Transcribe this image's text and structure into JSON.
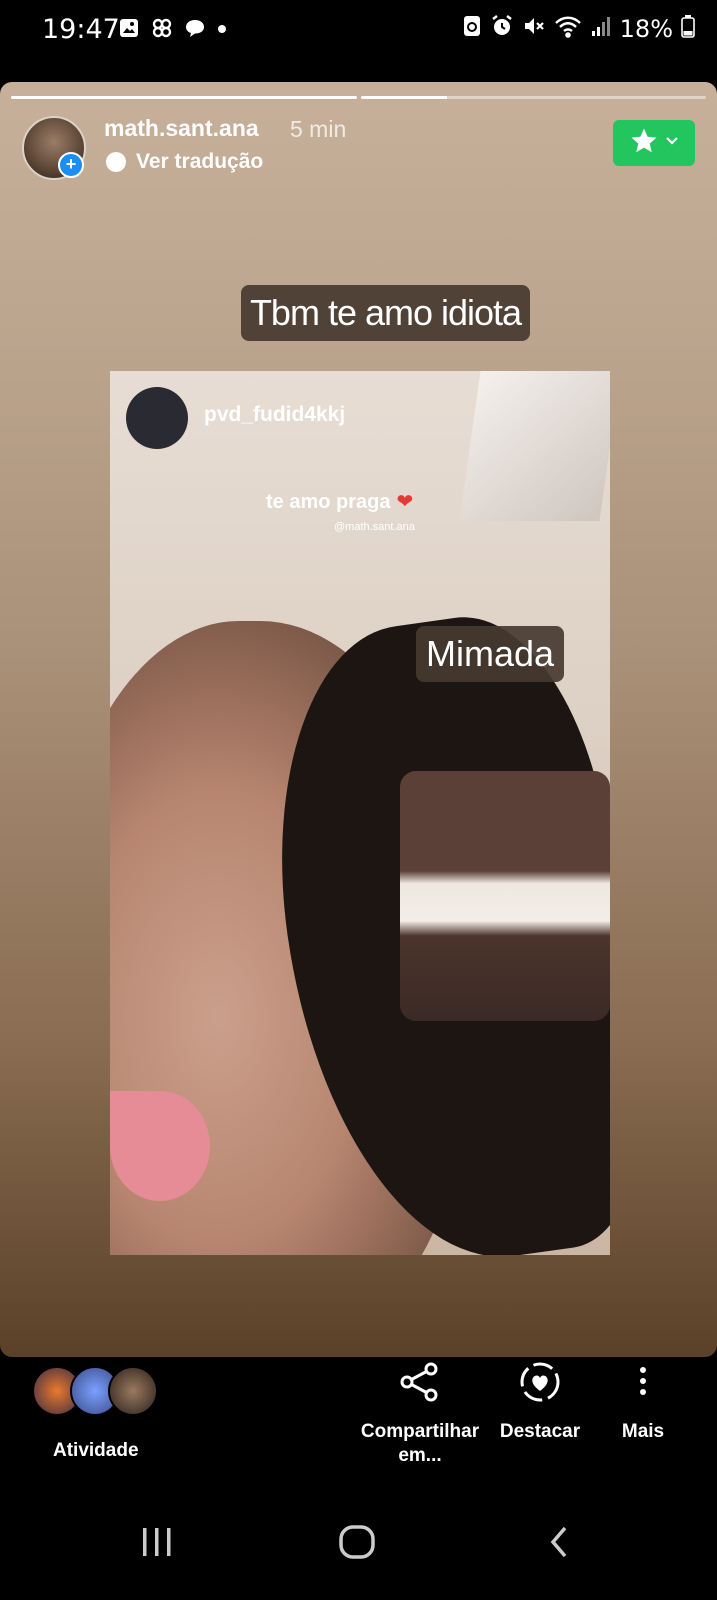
{
  "status_bar": {
    "time": "19:47",
    "battery": "18%",
    "left_icons": [
      "gallery-icon",
      "pinwheel-icon",
      "chat-bubble-icon",
      "dot-icon"
    ],
    "right_icons": [
      "sync-icon",
      "alarm-icon",
      "mute-icon",
      "wifi-icon",
      "signal-icon",
      "battery-icon"
    ]
  },
  "story": {
    "progress": [
      1.0,
      0.25
    ],
    "username": "math.sant.ana",
    "time_ago": "5 min",
    "translate_label": "Ver tradução",
    "caption": "Tbm te amo idiota",
    "shared_post": {
      "username": "pvd_fudid4kkj",
      "text": "te amo praga",
      "mention": "@math.sant.ana",
      "caption": "Mimada"
    },
    "favorite_color": "#22c55e"
  },
  "actions": {
    "activity_label": "Atividade",
    "share_label_1": "Compartilhar",
    "share_label_2": "em...",
    "highlight_label": "Destacar",
    "more_label": "Mais"
  }
}
